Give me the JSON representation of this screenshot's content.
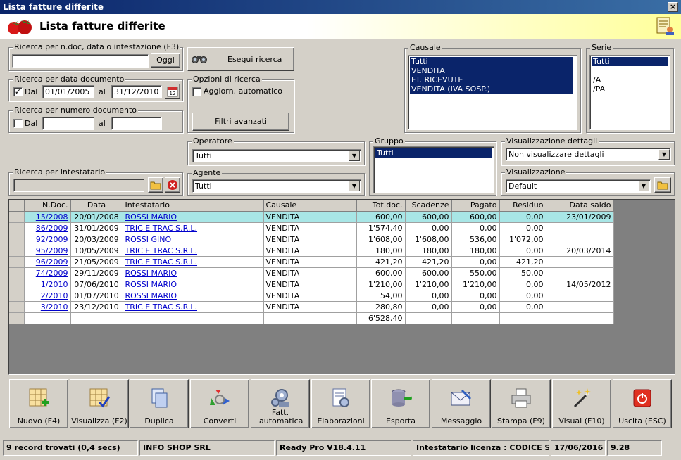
{
  "window": {
    "title": "Lista fatture differite",
    "close_label": "×"
  },
  "header": {
    "title": "Lista fatture differite"
  },
  "search_text": {
    "label": "Ricerca per n.doc, data o intestazione (F3)",
    "value": "",
    "button": "Oggi"
  },
  "search_button": "Esegui ricerca",
  "date_search": {
    "label": "Ricerca per data documento",
    "checked": true,
    "check_label": "Dal",
    "from": "01/01/2005",
    "to_label": "al",
    "to": "31/12/2010",
    "calendar_icon": "calendar-icon"
  },
  "options": {
    "label": "Opzioni di ricerca",
    "auto_update_label": "Aggiorn. automatico",
    "auto_update_checked": false,
    "advanced_filters": "Filtri avanzati"
  },
  "num_search": {
    "label": "Ricerca per numero documento",
    "check_label": "Dal",
    "from": "",
    "to_label": "al",
    "to": ""
  },
  "causale": {
    "label": "Causale",
    "items": [
      "Tutti",
      "VENDITA",
      "FT. RICEVUTE",
      "VENDITA (IVA SOSP.)"
    ]
  },
  "serie": {
    "label": "Serie",
    "items": [
      "Tutti",
      "",
      "/A",
      "/PA"
    ]
  },
  "operatore": {
    "label": "Operatore",
    "value": "Tutti"
  },
  "gruppo": {
    "label": "Gruppo",
    "items": [
      "Tutti"
    ]
  },
  "vis_dettagli": {
    "label": "Visualizzazione dettagli",
    "value": "Non visualizzare dettagli"
  },
  "intestatario": {
    "label": "Ricerca per intestatario",
    "value": ""
  },
  "agente": {
    "label": "Agente",
    "value": "Tutti"
  },
  "visualizzazione": {
    "label": "Visualizzazione",
    "value": "Default"
  },
  "table": {
    "columns": [
      "N.Doc.",
      "Data",
      "Intestatario",
      "Causale",
      "Tot.doc.",
      "Scadenze",
      "Pagato",
      "Residuo",
      "Data saldo"
    ],
    "rows": [
      [
        "15/2008",
        "20/01/2008",
        "ROSSI MARIO",
        "VENDITA",
        "600,00",
        "600,00",
        "600,00",
        "0,00",
        "23/01/2009"
      ],
      [
        "86/2009",
        "31/01/2009",
        "TRIC E TRAC S.R.L.",
        "VENDITA",
        "1'574,40",
        "0,00",
        "0,00",
        "0,00",
        ""
      ],
      [
        "92/2009",
        "20/03/2009",
        "ROSSI GINO",
        "VENDITA",
        "1'608,00",
        "1'608,00",
        "536,00",
        "1'072,00",
        ""
      ],
      [
        "95/2009",
        "10/05/2009",
        "TRIC E TRAC S.R.L.",
        "VENDITA",
        "180,00",
        "180,00",
        "180,00",
        "0,00",
        "20/03/2014"
      ],
      [
        "96/2009",
        "21/05/2009",
        "TRIC E TRAC S.R.L.",
        "VENDITA",
        "421,20",
        "421,20",
        "0,00",
        "421,20",
        ""
      ],
      [
        "74/2009",
        "29/11/2009",
        "ROSSI MARIO",
        "VENDITA",
        "600,00",
        "600,00",
        "550,00",
        "50,00",
        ""
      ],
      [
        "1/2010",
        "07/06/2010",
        "ROSSI MARIO",
        "VENDITA",
        "1'210,00",
        "1'210,00",
        "1'210,00",
        "0,00",
        "14/05/2012"
      ],
      [
        "2/2010",
        "01/07/2010",
        "ROSSI MARIO",
        "VENDITA",
        "54,00",
        "0,00",
        "0,00",
        "0,00",
        ""
      ],
      [
        "3/2010",
        "23/12/2010",
        "TRIC E TRAC S.R.L.",
        "VENDITA",
        "280,80",
        "0,00",
        "0,00",
        "0,00",
        ""
      ]
    ],
    "total": "6'528,40"
  },
  "toolbar": [
    {
      "label": "Nuovo (F4)",
      "icon": "new-icon"
    },
    {
      "label": "Visualizza (F2)",
      "icon": "view-icon"
    },
    {
      "label": "Duplica",
      "icon": "duplicate-icon"
    },
    {
      "label": "Converti",
      "icon": "convert-icon"
    },
    {
      "label": "Fatt. automatica",
      "icon": "auto-invoice-icon"
    },
    {
      "label": "Elaborazioni",
      "icon": "processing-icon"
    },
    {
      "label": "Esporta",
      "icon": "export-icon"
    },
    {
      "label": "Messaggio",
      "icon": "message-icon"
    },
    {
      "label": "Stampa (F9)",
      "icon": "print-icon"
    },
    {
      "label": "Visual (F10)",
      "icon": "wand-icon"
    },
    {
      "label": "Uscita (ESC)",
      "icon": "exit-icon"
    }
  ],
  "status": {
    "records": "9 record trovati (0,4 secs)",
    "company": "INFO SHOP SRL",
    "version": "Ready Pro V18.4.11",
    "license": "Intestatario licenza : CODICE SRL",
    "date": "17/06/2016",
    "time": "9.28"
  }
}
